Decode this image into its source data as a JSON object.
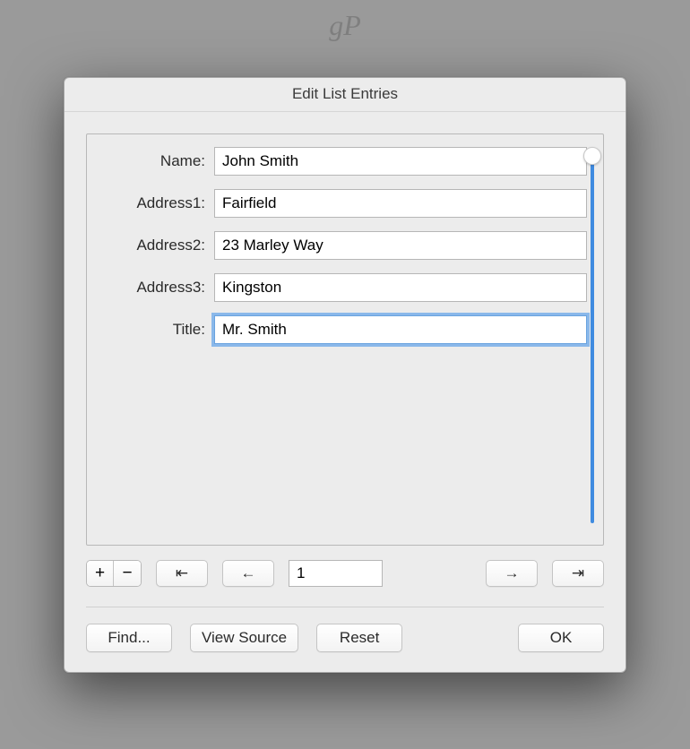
{
  "watermark": "gP",
  "dialog": {
    "title": "Edit List Entries"
  },
  "fields": {
    "name": {
      "label": "Name:",
      "value": "John Smith"
    },
    "address1": {
      "label": "Address1:",
      "value": "Fairfield"
    },
    "address2": {
      "label": "Address2:",
      "value": "23 Marley Way"
    },
    "address3": {
      "label": "Address3:",
      "value": "Kingston"
    },
    "title": {
      "label": "Title:",
      "value": "Mr. Smith"
    }
  },
  "nav": {
    "add_label": "+",
    "remove_label": "−",
    "first_label": "⇤",
    "prev_label": "←",
    "record_value": "1",
    "next_label": "→",
    "last_label": "⇥"
  },
  "buttons": {
    "find": "Find...",
    "view_source": "View Source",
    "reset": "Reset",
    "ok": "OK"
  }
}
